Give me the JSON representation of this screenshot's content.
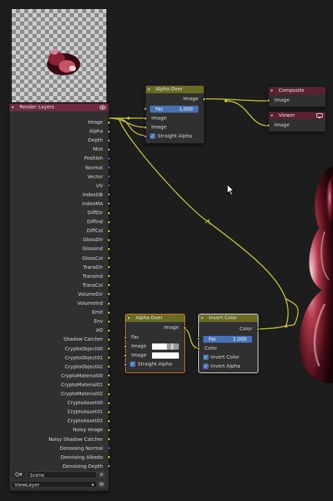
{
  "render_layers": {
    "title": "Render Layers",
    "outputs": [
      {
        "label": "Image",
        "type": "color"
      },
      {
        "label": "Alpha",
        "type": "float"
      },
      {
        "label": "Depth",
        "type": "float"
      },
      {
        "label": "Mist",
        "type": "float"
      },
      {
        "label": "Position",
        "type": "vector"
      },
      {
        "label": "Normal",
        "type": "vector"
      },
      {
        "label": "Vector",
        "type": "vector"
      },
      {
        "label": "UV",
        "type": "vector"
      },
      {
        "label": "IndexOB",
        "type": "float"
      },
      {
        "label": "IndexMA",
        "type": "float"
      },
      {
        "label": "DiffDir",
        "type": "color"
      },
      {
        "label": "DiffInd",
        "type": "color"
      },
      {
        "label": "DiffCol",
        "type": "color"
      },
      {
        "label": "GlossDir",
        "type": "color"
      },
      {
        "label": "GlossInd",
        "type": "color"
      },
      {
        "label": "GlossCol",
        "type": "color"
      },
      {
        "label": "TransDir",
        "type": "color"
      },
      {
        "label": "TransInd",
        "type": "color"
      },
      {
        "label": "TransCol",
        "type": "color"
      },
      {
        "label": "VolumeDir",
        "type": "color"
      },
      {
        "label": "VolumeInd",
        "type": "color"
      },
      {
        "label": "Emit",
        "type": "color"
      },
      {
        "label": "Env",
        "type": "color"
      },
      {
        "label": "AO",
        "type": "color"
      },
      {
        "label": "Shadow Catcher",
        "type": "color"
      },
      {
        "label": "CryptoObject00",
        "type": "color"
      },
      {
        "label": "CryptoObject01",
        "type": "color"
      },
      {
        "label": "CryptoObject02",
        "type": "color"
      },
      {
        "label": "CryptoMaterial00",
        "type": "color"
      },
      {
        "label": "CryptoMaterial01",
        "type": "color"
      },
      {
        "label": "CryptoMaterial02",
        "type": "color"
      },
      {
        "label": "CryptoAsset00",
        "type": "color"
      },
      {
        "label": "CryptoAsset01",
        "type": "color"
      },
      {
        "label": "CryptoAsset02",
        "type": "color"
      },
      {
        "label": "Noisy Image",
        "type": "color"
      },
      {
        "label": "Noisy Shadow Catcher",
        "type": "color"
      },
      {
        "label": "Denoising Normal",
        "type": "vector"
      },
      {
        "label": "Denoising Albedo",
        "type": "color"
      },
      {
        "label": "Denoising Depth",
        "type": "float"
      }
    ],
    "scene": "Scene",
    "view_layer": "ViewLayer"
  },
  "alpha_over_top": {
    "title": "Alpha Over",
    "output": "Image",
    "fac_label": "Fac",
    "fac_value": "1.000",
    "input1": "Image",
    "input2": "Image",
    "straight_alpha": "Straight Alpha"
  },
  "composite": {
    "title": "Composite",
    "input": "Image"
  },
  "viewer": {
    "title": "Viewer",
    "input": "Image"
  },
  "alpha_over_bottom": {
    "title": "Alpha Over",
    "output": "Image",
    "fac_label": "Fac",
    "input1": "Image",
    "input2": "Image",
    "straight_alpha": "Straight Alpha"
  },
  "invert_color": {
    "title": "Invert Color",
    "output": "Color",
    "fac_label": "Fac",
    "fac_value": "1.000",
    "input": "Color",
    "invert_color": "Invert Color",
    "invert_alpha": "Invert Alpha"
  },
  "colors": {
    "color_socket": "#c7c729",
    "float_socket": "#a1a1a1",
    "vector_socket": "#6363c7",
    "wire": "#c9c62a",
    "field_blue": "#4772b3",
    "mix_header": "#6a6b22",
    "output_header": "#5a2231"
  },
  "icons": {
    "render_layer_eye": "eye-icon",
    "viewer_monitor": "monitor-icon",
    "scene_dropdown": "scene-icon",
    "clear": "close-icon"
  }
}
